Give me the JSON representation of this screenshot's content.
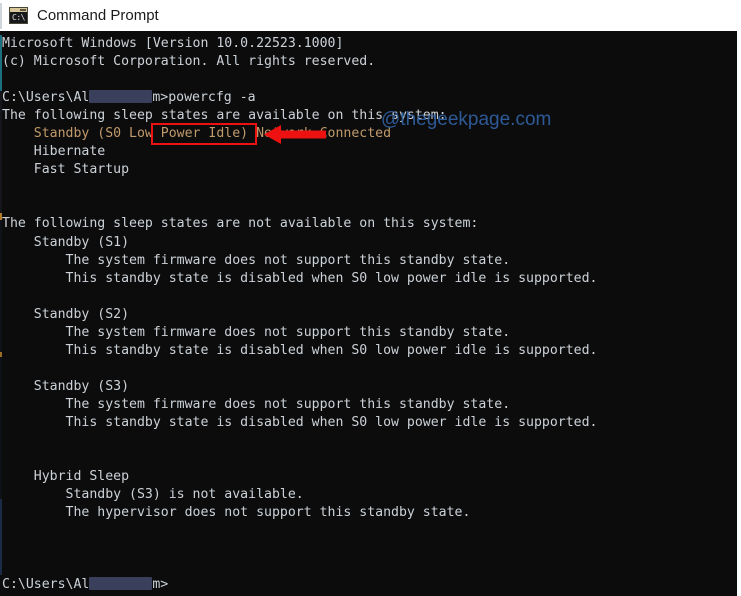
{
  "window": {
    "title": "Command Prompt",
    "icon": "command-prompt-icon",
    "icon_glyph": "C:\\",
    "background": "#0c0c0c",
    "text_color": "#ccd2d8",
    "accent_color": "#c19a6b"
  },
  "watermark": {
    "text": "@thegeekpage.com",
    "color": "#2f5f9e"
  },
  "annotation": {
    "highlight_color": "#ee1111",
    "arrow_color": "#ee1111",
    "highlighted_command": "powercfg -a",
    "arrow_direction": "left"
  },
  "terminal": {
    "prompt_path": "C:\\Users\\Al",
    "prompt_suffix": "m>",
    "command": "powercfg -a",
    "lines": [
      {
        "text": "Microsoft Windows [Version 10.0.22523.1000]",
        "color": "default"
      },
      {
        "text": "(c) Microsoft Corporation. All rights reserved.",
        "color": "default"
      },
      {
        "text": "",
        "color": "default"
      },
      {
        "text": "__PROMPT_COMMAND__",
        "color": "default"
      },
      {
        "text": "The following sleep states are available on this system:",
        "color": "default"
      },
      {
        "text": "    Standby (S0 Low Power Idle) Network Connected",
        "color": "orange"
      },
      {
        "text": "    Hibernate",
        "color": "default"
      },
      {
        "text": "    Fast Startup",
        "color": "default"
      },
      {
        "text": "",
        "color": "default"
      },
      {
        "text": "",
        "color": "default"
      },
      {
        "text": "The following sleep states are not available on this system:",
        "color": "default"
      },
      {
        "text": "    Standby (S1)",
        "color": "default"
      },
      {
        "text": "        The system firmware does not support this standby state.",
        "color": "default"
      },
      {
        "text": "        This standby state is disabled when S0 low power idle is supported.",
        "color": "default"
      },
      {
        "text": "",
        "color": "default"
      },
      {
        "text": "    Standby (S2)",
        "color": "default"
      },
      {
        "text": "        The system firmware does not support this standby state.",
        "color": "default"
      },
      {
        "text": "        This standby state is disabled when S0 low power idle is supported.",
        "color": "default"
      },
      {
        "text": "",
        "color": "default"
      },
      {
        "text": "    Standby (S3)",
        "color": "default"
      },
      {
        "text": "        The system firmware does not support this standby state.",
        "color": "default"
      },
      {
        "text": "        This standby state is disabled when S0 low power idle is supported.",
        "color": "default"
      },
      {
        "text": "",
        "color": "default"
      },
      {
        "text": "",
        "color": "default"
      },
      {
        "text": "    Hybrid Sleep",
        "color": "default"
      },
      {
        "text": "        Standby (S3) is not available.",
        "color": "default"
      },
      {
        "text": "        The hypervisor does not support this standby state.",
        "color": "default"
      },
      {
        "text": "",
        "color": "default"
      },
      {
        "text": "",
        "color": "default"
      },
      {
        "text": "",
        "color": "default"
      },
      {
        "text": "__PROMPT_ONLY__",
        "color": "default"
      }
    ]
  }
}
